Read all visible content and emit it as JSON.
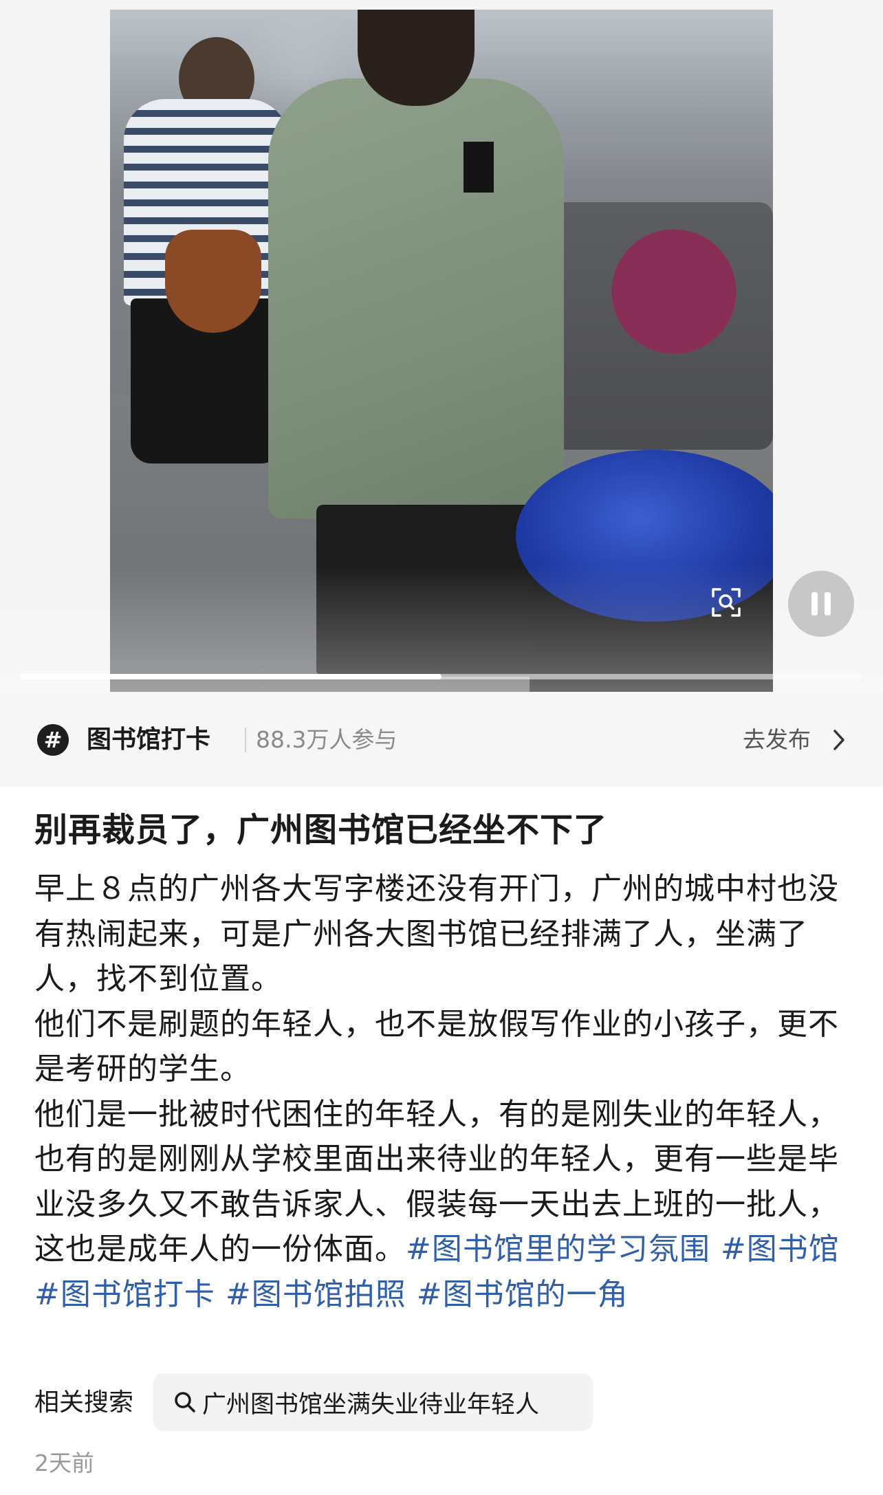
{
  "video": {
    "progress_fraction": 0.5
  },
  "topic": {
    "icon": "hashtag-icon",
    "name": "图书馆打卡",
    "participants": "88.3万人参与",
    "publish_label": "去发布"
  },
  "article": {
    "title": "别再裁员了，广州图书馆已经坐不下了",
    "paragraph_1": "早上８点的广州各大写字楼还没有开门，广州的城中村也没有热闹起来，可是广州各大图书馆已经排满了人，坐满了人，找不到位置。",
    "paragraph_2": "他们不是刷题的年轻人，也不是放假写作业的小孩子，更不是考研的学生。",
    "paragraph_3": "他们是一批被时代困住的年轻人，有的是刚失业的年轻人，也有的是刚刚从学校里面出来待业的年轻人，更有一些是毕业没多久又不敢告诉家人、假装每一天出去上班的一批人，这也是成年人的一份体面。",
    "hashtags": [
      "#图书馆里的学习氛围",
      "#图书馆",
      "#图书馆打卡",
      "#图书馆拍照",
      "#图书馆的一角"
    ]
  },
  "related": {
    "label": "相关搜索",
    "query": "广州图书馆坐满失业待业年轻人"
  },
  "timestamp": "2天前",
  "colors": {
    "hashtag": "#2f5fa8",
    "topic_bar_bg": "#f6f6f6",
    "chip_bg": "#f3f3f3"
  }
}
